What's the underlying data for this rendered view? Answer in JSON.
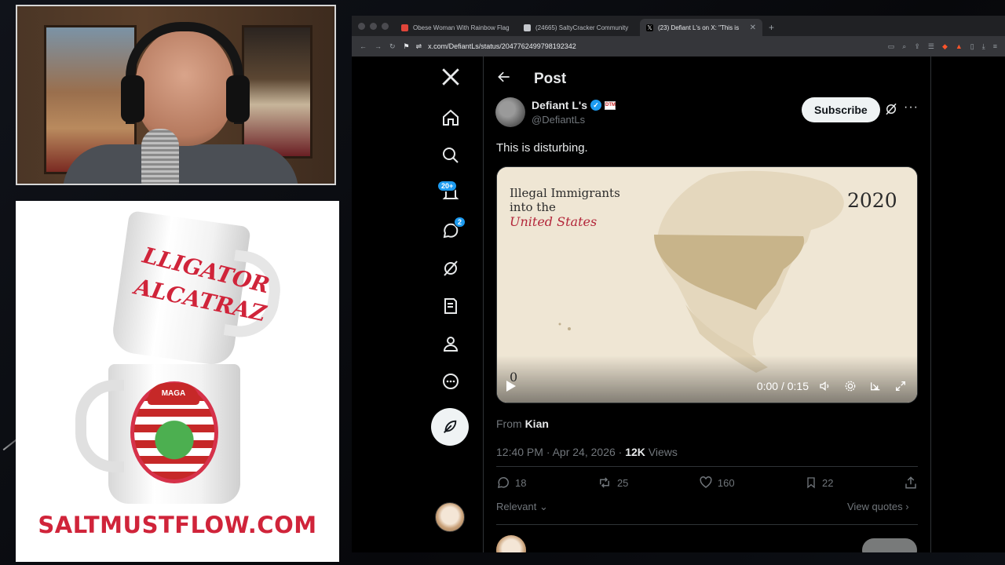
{
  "merch": {
    "mug_top_line1": "LLIGATOR",
    "mug_top_line2": "ALCATRAZ",
    "mug_cap": "MAGA",
    "url": "SALTMUSTFLOW.COM"
  },
  "browser": {
    "tabs": [
      {
        "title": "Obese Woman With Rainbow Flag",
        "favicon_color": "#e0453a",
        "active": false
      },
      {
        "title": "(24665) SaltyCracker Community",
        "favicon_color": "#c4c7cc",
        "active": false
      },
      {
        "title": "(23) Defiant L's on X: \"This is",
        "favicon_color": "#ffffff",
        "active": true
      }
    ],
    "url": "x.com/DefiantLs/status/2047762499798192342"
  },
  "xnav": {
    "notifications_badge": "20+",
    "messages_badge": "2"
  },
  "post": {
    "header_title": "Post",
    "author_name": "Defiant L's",
    "author_handle": "@DefiantLs",
    "subscribe_label": "Subscribe",
    "text": "This is disturbing.",
    "video": {
      "title_line1": "Illegal Immigrants",
      "title_line2": "into the",
      "title_highlight": "United States",
      "year": "2020",
      "counter": "0",
      "time": "0:00 / 0:15"
    },
    "from_label": "From",
    "from_name": "Kian",
    "timestamp": "12:40 PM · Apr 24, 2026 · ",
    "views_count": "12K",
    "views_label": " Views",
    "replies": "18",
    "reposts": "25",
    "likes": "160",
    "bookmarks": "22",
    "sort_label": "Relevant",
    "view_quotes_label": "View quotes"
  },
  "colors": {
    "accent": "#1d9bf0",
    "merch_red": "#d0243a",
    "map_land": "#c8b48a"
  }
}
